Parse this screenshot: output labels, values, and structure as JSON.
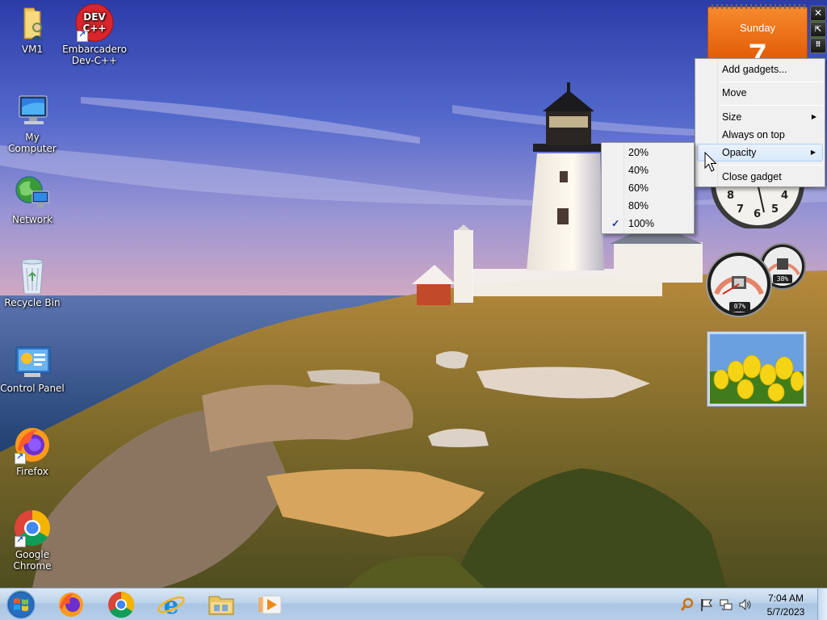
{
  "desktop": {
    "icons": [
      {
        "label": "VM1",
        "icon": "user-folder-icon"
      },
      {
        "label": "Embarcadero Dev-C++",
        "icon": "devcpp-icon",
        "badge": "DEV\nC++"
      },
      {
        "label": "My Computer",
        "icon": "computer-icon"
      },
      {
        "label": "Network",
        "icon": "network-icon"
      },
      {
        "label": "Recycle Bin",
        "icon": "recycle-bin-icon"
      },
      {
        "label": "Control Panel",
        "icon": "control-panel-icon"
      },
      {
        "label": "Firefox",
        "icon": "firefox-icon"
      },
      {
        "label": "Google Chrome",
        "icon": "chrome-icon"
      }
    ]
  },
  "gadgets": {
    "calendar": {
      "weekday": "Sunday",
      "day": "7"
    },
    "cpu_meter": {
      "cpu": "07%",
      "memory": "38%"
    }
  },
  "context_menu": {
    "items": [
      "Add gadgets...",
      "Move",
      "Size",
      "Always on top",
      "Opacity",
      "Close gadget"
    ],
    "highlighted": "Opacity"
  },
  "opacity_submenu": {
    "items": [
      "20%",
      "40%",
      "60%",
      "80%",
      "100%"
    ],
    "checked": "100%"
  },
  "taskbar": {
    "pinned": [
      "start-button",
      "firefox",
      "chrome",
      "internet-explorer",
      "file-explorer",
      "media-player"
    ],
    "time": "7:04 AM",
    "date": "5/7/2023"
  },
  "colors": {
    "calendar_orange": "#f26a10",
    "taskbar": "#bcd3ea",
    "menu_highlight": "#d9e9fb"
  }
}
